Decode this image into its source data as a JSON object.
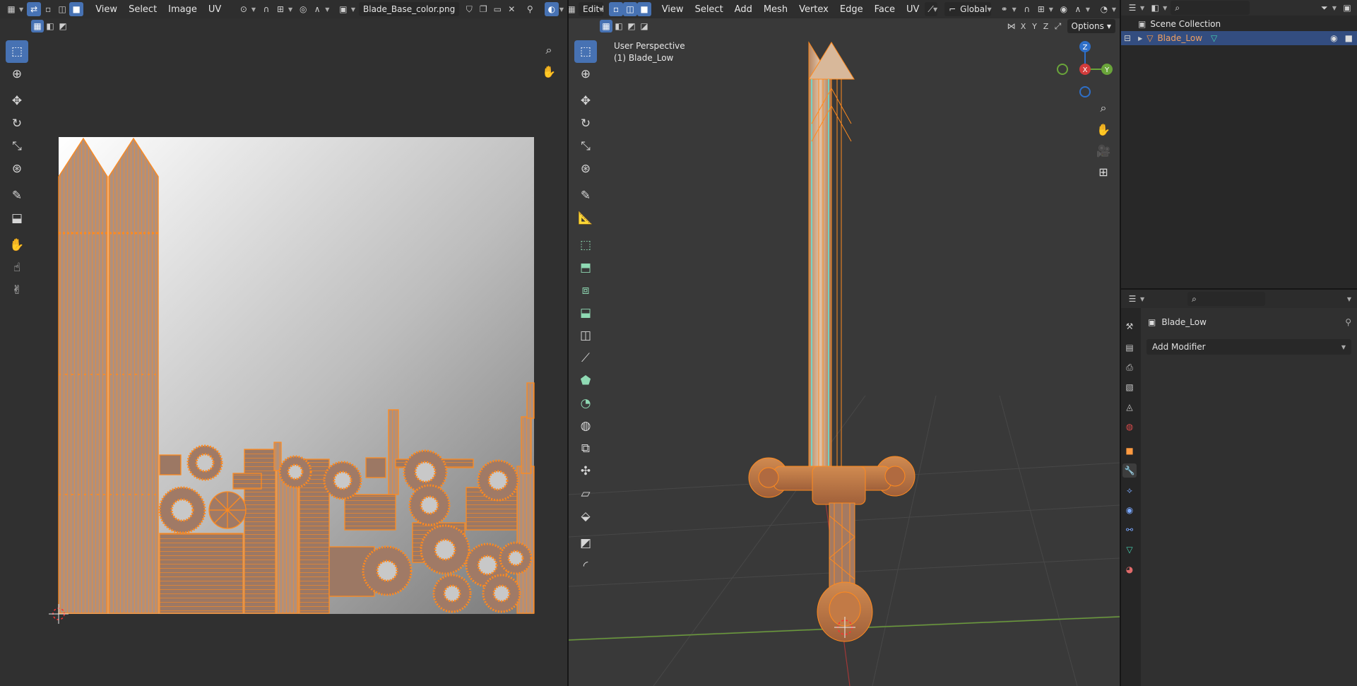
{
  "uv_editor": {
    "menus": [
      "View",
      "Select",
      "Image",
      "UV"
    ],
    "image_name": "Blade_Base_color.png"
  },
  "viewport": {
    "mode": "Edit Mode",
    "menus": [
      "View",
      "Select",
      "Add",
      "Mesh",
      "Vertex",
      "Edge",
      "Face",
      "UV"
    ],
    "transform_orientation": "Global",
    "options_label": "Options",
    "axes_buttons": [
      "X",
      "Y",
      "Z"
    ],
    "view_name": "User Perspective",
    "object_label": "(1) Blade_Low",
    "gizmo_axes": [
      "Z",
      "X",
      "Y"
    ]
  },
  "outliner": {
    "collection": "Scene Collection",
    "object": "Blade_Low"
  },
  "properties": {
    "object_name": "Blade_Low",
    "add_modifier": "Add Modifier"
  },
  "colors": {
    "accent": "#4772b3",
    "uv_orange": "#ff8a1e",
    "panel": "#303030",
    "header": "#2e2e2e",
    "selection_row": "#334d80"
  }
}
